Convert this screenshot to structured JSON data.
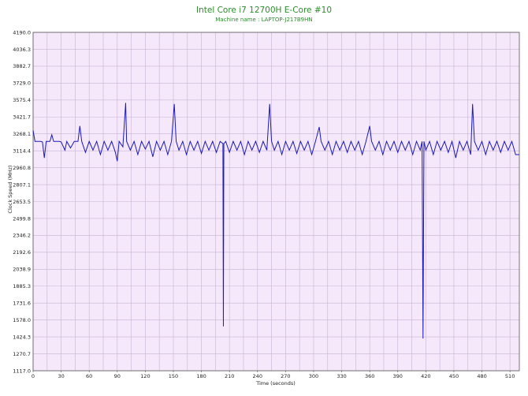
{
  "chart_data": {
    "type": "line",
    "title": "Intel Core i7 12700H E-Core #10",
    "subtitle": "Machine name : LAPTOP-J217B9HN",
    "xlabel": "Time (seconds)",
    "ylabel": "Clock Speed (MHz)",
    "xlim": [
      0,
      520
    ],
    "ylim": [
      1117.0,
      4190.0
    ],
    "x_ticks": [
      0,
      30,
      60,
      90,
      120,
      150,
      180,
      210,
      240,
      270,
      300,
      330,
      360,
      390,
      420,
      450,
      480,
      510
    ],
    "y_ticks": [
      "1117.0",
      "1270.7",
      "1424.3",
      "1578.0",
      "1731.6",
      "1885.3",
      "2038.9",
      "2192.6",
      "2346.2",
      "2499.8",
      "2653.5",
      "2807.1",
      "2960.8",
      "3114.4",
      "3268.1",
      "3421.7",
      "3575.4",
      "3729.0",
      "3882.7",
      "4036.3",
      "4190.0"
    ],
    "grid": true,
    "background_color": "#f6e8fb",
    "grid_color": "#c7b3d3",
    "line_color": "#1a1ab8",
    "title_color": "#2e8b2e",
    "series": [
      {
        "values": [
          [
            0,
            3300
          ],
          [
            2,
            3200
          ],
          [
            8,
            3200
          ],
          [
            10,
            3195
          ],
          [
            12,
            3050
          ],
          [
            14,
            3200
          ],
          [
            18,
            3200
          ],
          [
            20,
            3260
          ],
          [
            22,
            3200
          ],
          [
            28,
            3200
          ],
          [
            30,
            3195
          ],
          [
            34,
            3120
          ],
          [
            36,
            3200
          ],
          [
            40,
            3140
          ],
          [
            44,
            3200
          ],
          [
            48,
            3200
          ],
          [
            50,
            3340
          ],
          [
            52,
            3200
          ],
          [
            56,
            3100
          ],
          [
            60,
            3200
          ],
          [
            64,
            3120
          ],
          [
            68,
            3200
          ],
          [
            72,
            3080
          ],
          [
            76,
            3200
          ],
          [
            80,
            3120
          ],
          [
            84,
            3200
          ],
          [
            88,
            3100
          ],
          [
            90,
            3020
          ],
          [
            92,
            3200
          ],
          [
            96,
            3150
          ],
          [
            99,
            3550
          ],
          [
            100,
            3200
          ],
          [
            104,
            3120
          ],
          [
            108,
            3200
          ],
          [
            112,
            3080
          ],
          [
            116,
            3200
          ],
          [
            120,
            3130
          ],
          [
            124,
            3200
          ],
          [
            128,
            3060
          ],
          [
            132,
            3200
          ],
          [
            136,
            3120
          ],
          [
            140,
            3200
          ],
          [
            144,
            3080
          ],
          [
            148,
            3200
          ],
          [
            151,
            3540
          ],
          [
            153,
            3200
          ],
          [
            156,
            3120
          ],
          [
            160,
            3200
          ],
          [
            164,
            3080
          ],
          [
            168,
            3200
          ],
          [
            172,
            3120
          ],
          [
            176,
            3200
          ],
          [
            180,
            3090
          ],
          [
            184,
            3200
          ],
          [
            188,
            3120
          ],
          [
            192,
            3200
          ],
          [
            196,
            3100
          ],
          [
            200,
            3200
          ],
          [
            203,
            3180
          ],
          [
            203.5,
            1520
          ],
          [
            204,
            3180
          ],
          [
            206,
            3200
          ],
          [
            210,
            3100
          ],
          [
            214,
            3200
          ],
          [
            218,
            3120
          ],
          [
            222,
            3200
          ],
          [
            226,
            3080
          ],
          [
            230,
            3200
          ],
          [
            234,
            3120
          ],
          [
            238,
            3200
          ],
          [
            242,
            3100
          ],
          [
            246,
            3200
          ],
          [
            250,
            3120
          ],
          [
            253,
            3540
          ],
          [
            255,
            3200
          ],
          [
            258,
            3120
          ],
          [
            262,
            3200
          ],
          [
            266,
            3080
          ],
          [
            270,
            3200
          ],
          [
            274,
            3120
          ],
          [
            278,
            3200
          ],
          [
            282,
            3090
          ],
          [
            286,
            3200
          ],
          [
            290,
            3120
          ],
          [
            294,
            3200
          ],
          [
            298,
            3080
          ],
          [
            302,
            3200
          ],
          [
            306,
            3330
          ],
          [
            308,
            3200
          ],
          [
            312,
            3120
          ],
          [
            316,
            3200
          ],
          [
            320,
            3080
          ],
          [
            324,
            3200
          ],
          [
            328,
            3120
          ],
          [
            332,
            3200
          ],
          [
            336,
            3100
          ],
          [
            340,
            3200
          ],
          [
            344,
            3120
          ],
          [
            348,
            3200
          ],
          [
            352,
            3080
          ],
          [
            356,
            3200
          ],
          [
            360,
            3340
          ],
          [
            362,
            3200
          ],
          [
            366,
            3120
          ],
          [
            370,
            3200
          ],
          [
            374,
            3080
          ],
          [
            378,
            3200
          ],
          [
            382,
            3120
          ],
          [
            386,
            3200
          ],
          [
            390,
            3100
          ],
          [
            394,
            3200
          ],
          [
            398,
            3120
          ],
          [
            402,
            3200
          ],
          [
            406,
            3080
          ],
          [
            410,
            3200
          ],
          [
            414,
            3120
          ],
          [
            416,
            3200
          ],
          [
            417,
            1410
          ],
          [
            418,
            3200
          ],
          [
            420,
            3120
          ],
          [
            424,
            3200
          ],
          [
            428,
            3080
          ],
          [
            432,
            3200
          ],
          [
            436,
            3120
          ],
          [
            440,
            3200
          ],
          [
            444,
            3100
          ],
          [
            448,
            3200
          ],
          [
            452,
            3050
          ],
          [
            456,
            3200
          ],
          [
            460,
            3120
          ],
          [
            464,
            3200
          ],
          [
            468,
            3080
          ],
          [
            470,
            3540
          ],
          [
            472,
            3200
          ],
          [
            476,
            3120
          ],
          [
            480,
            3200
          ],
          [
            484,
            3080
          ],
          [
            488,
            3200
          ],
          [
            492,
            3120
          ],
          [
            496,
            3200
          ],
          [
            500,
            3100
          ],
          [
            504,
            3200
          ],
          [
            508,
            3120
          ],
          [
            512,
            3200
          ],
          [
            516,
            3080
          ],
          [
            520,
            3080
          ]
        ]
      }
    ]
  }
}
